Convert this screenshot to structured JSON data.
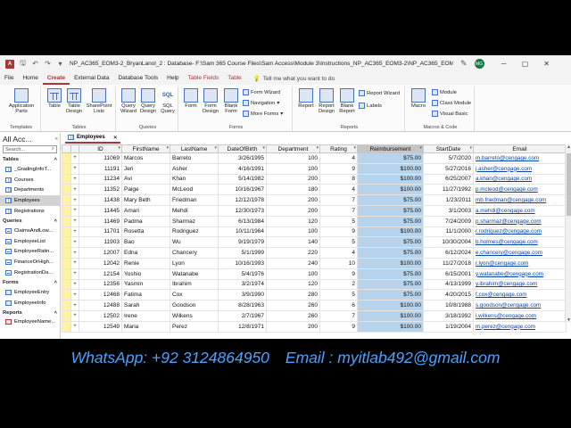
{
  "titlebar": {
    "app_icon": "A",
    "filename": "NP_AC365_EOM3-2_BryanLanol_2 : Database- F:\\Sam 365 Course Files\\Sam Access\\Module 3\\Instructions_NP_AC365_EOM3-2\\NP_AC365_EOM3-2_BryanLanol_...",
    "avatar": "MG"
  },
  "menu": [
    "File",
    "Home",
    "Create",
    "External Data",
    "Database Tools",
    "Help",
    "Table Fields",
    "Table"
  ],
  "tell_me": "Tell me what you want to do",
  "ribbon": {
    "templates": {
      "label": "Templates",
      "app_parts": "Application Parts"
    },
    "tables": {
      "label": "Tables",
      "table": "Table",
      "table_design": "Table Design",
      "sharepoint": "SharePoint Lists"
    },
    "queries": {
      "label": "Queries",
      "wizard": "Query Wizard",
      "design": "Query Design",
      "sql": "SQL Query",
      "sql_icon": "SQL"
    },
    "forms": {
      "label": "Forms",
      "form": "Form",
      "form_design": "Form Design",
      "blank_form": "Blank Form",
      "form_wizard": "Form Wizard",
      "navigation": "Navigation",
      "more_forms": "More Forms"
    },
    "reports": {
      "label": "Reports",
      "report": "Report",
      "report_design": "Report Design",
      "blank_report": "Blank Report",
      "report_wizard": "Report Wizard",
      "labels": "Labels"
    },
    "macros": {
      "label": "Macros & Code",
      "macro": "Macro",
      "module": "Module",
      "class_module": "Class Module",
      "visual_basic": "Visual Basic"
    }
  },
  "nav": {
    "title": "All Acc...",
    "search_placeholder": "Search...",
    "sections": [
      {
        "name": "Tables",
        "items": [
          "_GradingInfoT...",
          "Courses",
          "Departments",
          "Employees",
          "Registrations"
        ]
      },
      {
        "name": "Queries",
        "items": [
          "ClaimsAndLow...",
          "EmployeeList",
          "EmployeeRatin...",
          "FinanceOrHigh...",
          "RegistrationDa..."
        ]
      },
      {
        "name": "Forms",
        "items": [
          "EmployeeEntry",
          "EmployeeInfo"
        ]
      },
      {
        "name": "Reports",
        "items": [
          "EmployeeName..."
        ]
      }
    ]
  },
  "tab": {
    "label": "Employees"
  },
  "grid": {
    "columns": [
      "ID",
      "FirstName",
      "LastName",
      "DateOfBirth",
      "Department",
      "Rating",
      "Reimbursement",
      "StartDate",
      "Email"
    ],
    "rows": [
      [
        "11069",
        "Marcos",
        "Barreto",
        "3/26/1995",
        "100",
        "4",
        "$75.00",
        "5/7/2020",
        "m.barreto@cengage.com"
      ],
      [
        "11191",
        "Jeri",
        "Asher",
        "4/16/1991",
        "100",
        "9",
        "$100.00",
        "5/27/2016",
        "j.asher@cengage.com"
      ],
      [
        "11234",
        "Avi",
        "Khan",
        "5/14/1982",
        "200",
        "8",
        "$100.00",
        "6/25/2007",
        "a.khan@cengage.com"
      ],
      [
        "11352",
        "Paige",
        "McLeod",
        "10/16/1967",
        "180",
        "4",
        "$100.00",
        "11/27/1992",
        "p.mcleod@cengage.com"
      ],
      [
        "11438",
        "Mary Beth",
        "Friedman",
        "12/12/1978",
        "200",
        "7",
        "$75.00",
        "1/23/2011",
        "mb.friedman@cengage.com"
      ],
      [
        "11445",
        "Amari",
        "Mehdi",
        "12/30/1973",
        "200",
        "7",
        "$75.00",
        "3/1/2003",
        "a.mehdi@cengage.com"
      ],
      [
        "11469",
        "Padma",
        "Sharmaz",
        "6/13/1984",
        "120",
        "5",
        "$75.00",
        "7/24/2009",
        "p.sharmaz@cengage.com"
      ],
      [
        "11701",
        "Rosetta",
        "Rodriguez",
        "10/11/1964",
        "100",
        "9",
        "$100.00",
        "11/1/2000",
        "r.rodriguez@cengage.com"
      ],
      [
        "11903",
        "Bao",
        "Wu",
        "9/19/1979",
        "140",
        "5",
        "$75.00",
        "10/30/2004",
        "b.holmes@cengage.com"
      ],
      [
        "12007",
        "Edna",
        "Chancery",
        "5/1/1999",
        "220",
        "4",
        "$75.00",
        "6/12/2024",
        "e.chancery@cengage.com"
      ],
      [
        "12042",
        "Renie",
        "Lyon",
        "10/16/1993",
        "240",
        "10",
        "$100.00",
        "11/27/2018",
        "r.lyon@cengage.com"
      ],
      [
        "12154",
        "Yoshio",
        "Watanabe",
        "5/4/1976",
        "100",
        "9",
        "$75.00",
        "6/15/2001",
        "y.watanabe@cengage.com"
      ],
      [
        "12356",
        "Yasmin",
        "Ibrahim",
        "3/2/1974",
        "120",
        "2",
        "$75.00",
        "4/13/1999",
        "y.ibrahim@cengage.com"
      ],
      [
        "12468",
        "Fatima",
        "Cox",
        "3/9/1990",
        "280",
        "5",
        "$75.00",
        "4/20/2015",
        "f.cox@cengage.com"
      ],
      [
        "12488",
        "Sarah",
        "Goodson",
        "8/28/1963",
        "260",
        "6",
        "$100.00",
        "10/8/1988",
        "s.goodson@cengage.com"
      ],
      [
        "12502",
        "Irene",
        "Wilkens",
        "2/7/1967",
        "260",
        "7",
        "$100.00",
        "3/18/1992",
        "i.wilkens@cengage.com"
      ],
      [
        "12549",
        "Maria",
        "Perez",
        "12/8/1971",
        "200",
        "9",
        "$100.00",
        "1/19/2004",
        "m.perez@cengage.com"
      ]
    ]
  },
  "contact": {
    "whatsapp": "WhatsApp: +92 3124864950",
    "email": "Email : myitlab492@gmail.com"
  },
  "colors": {
    "accent": "#a4373a",
    "selection": "#b8d4ec",
    "contact": "#4aa3ff"
  }
}
